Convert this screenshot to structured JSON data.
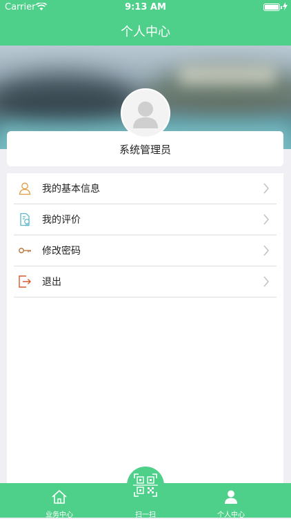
{
  "status_bar": {
    "carrier": "Carrier",
    "time": "9:13 AM"
  },
  "header": {
    "title": "个人中心"
  },
  "profile": {
    "username": "系统管理员"
  },
  "menu": {
    "items": [
      {
        "label": "我的基本信息",
        "icon": "user-outline-icon"
      },
      {
        "label": "我的评价",
        "icon": "evaluation-document-icon"
      },
      {
        "label": "修改密码",
        "icon": "key-icon"
      },
      {
        "label": "退出",
        "icon": "logout-icon"
      }
    ]
  },
  "tab_bar": {
    "tabs": [
      {
        "label": "业务中心",
        "icon": "home-icon"
      },
      {
        "label": "扫一扫",
        "icon": "qr-scan-icon"
      },
      {
        "label": "个人中心",
        "icon": "person-icon",
        "selected": true
      }
    ]
  },
  "colors": {
    "primary": "#4fd08a",
    "icon_orange": "#e29a3a",
    "icon_teal": "#5ab7c9",
    "icon_brown": "#b46c2c"
  }
}
